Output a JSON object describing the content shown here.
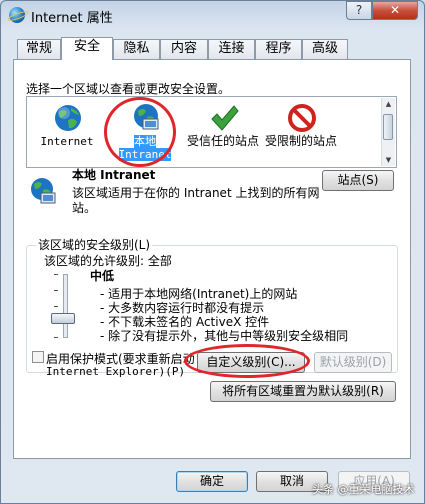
{
  "window": {
    "title": "Internet 属性",
    "help": "?",
    "close": "✕"
  },
  "tabs": [
    {
      "label": "常规"
    },
    {
      "label": "安全"
    },
    {
      "label": "隐私"
    },
    {
      "label": "内容"
    },
    {
      "label": "连接"
    },
    {
      "label": "程序"
    },
    {
      "label": "高级"
    }
  ],
  "security": {
    "prompt": "选择一个区域以查看或更改安全设置。",
    "zones": [
      {
        "label": "Internet",
        "icon": "globe-icon"
      },
      {
        "label": "本地 Intranet",
        "icon": "local-intranet-icon"
      },
      {
        "label": "受信任的站点",
        "icon": "checkmark-icon"
      },
      {
        "label": "受限制的站点",
        "icon": "no-entry-icon"
      }
    ],
    "selected_zone_title": "本地 Intranet",
    "selected_zone_desc": "该区域适用于在你的 Intranet 上找到的所有网站。",
    "sites_button": "站点(S)",
    "level_group": "该区域的安全级别(L)",
    "allowed_levels": "该区域的允许级别: 全部",
    "level_name": "中低",
    "bullets": [
      "- 适用于本地网络(Intranet)上的网站",
      "- 大多数内容运行时都没有提示",
      "- 不下载未签名的 ActiveX 控件",
      "- 除了没有提示外，其他与中等级别安全级相同"
    ],
    "protected_mode": "启用保护模式(要求重新启动",
    "protected_mode_2": "Internet Explorer)(P)",
    "custom_button": "自定义级别(C)...",
    "default_button": "默认级别(D)",
    "reset_button": "将所有区域重置为默认级别(R)"
  },
  "footer": {
    "ok": "确定",
    "cancel": "取消",
    "apply": "应用(A)"
  },
  "watermark": "头条 @重荣电脑技术",
  "colors": {
    "highlight": "#e0252b",
    "selection": "#3399ff"
  }
}
